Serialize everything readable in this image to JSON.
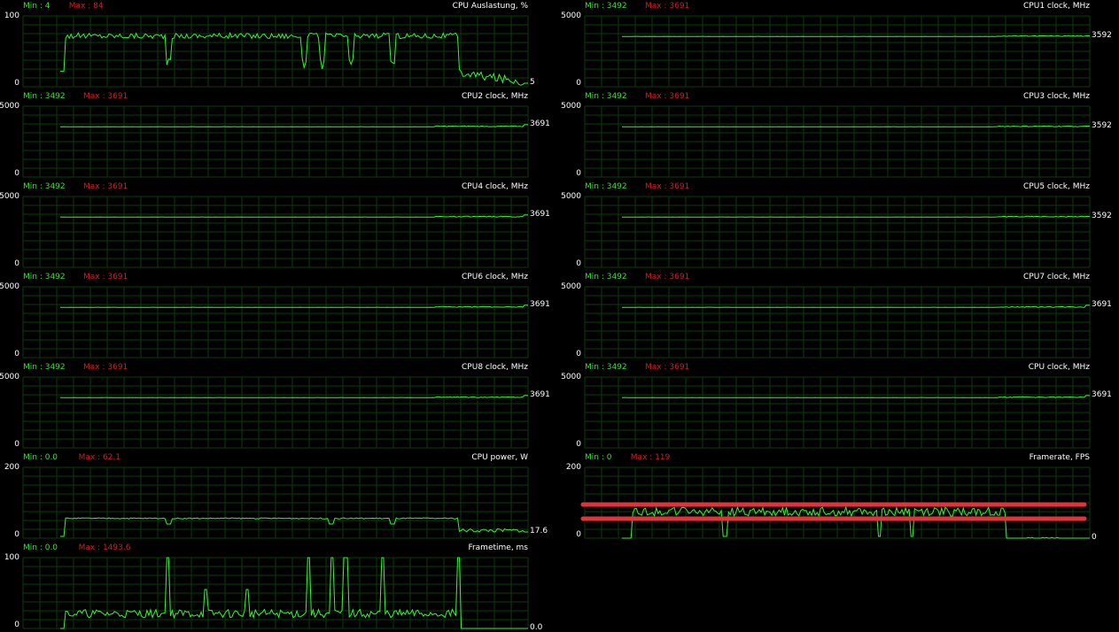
{
  "colors": {
    "background": "#000000",
    "grid": "#0b3a0b",
    "line": "#3cf03c",
    "min_text": "#3fdc3f",
    "max_text": "#d21e1e",
    "marker": "#e0343a"
  },
  "graphs": [
    {
      "id": "cpu-usage",
      "title": "CPU Auslastung, %",
      "min": "Min : 4",
      "max": "Max : 84",
      "top": "100",
      "bottom": "0",
      "current": "5",
      "ymax": 100,
      "profile": "usage",
      "base": 72,
      "endval": 5
    },
    {
      "id": "cpu1-clock",
      "title": "CPU1 clock, MHz",
      "min": "Min : 3492",
      "max": "Max : 3691",
      "top": "5000",
      "bottom": "0",
      "current": "3592",
      "ymax": 5000,
      "profile": "clock",
      "base": 3550,
      "endval": 3592
    },
    {
      "id": "cpu2-clock",
      "title": "CPU2 clock, MHz",
      "min": "Min : 3492",
      "max": "Max : 3691",
      "top": "5000",
      "bottom": "0",
      "current": "3691",
      "ymax": 5000,
      "profile": "clock",
      "base": 3550,
      "endval": 3691
    },
    {
      "id": "cpu3-clock",
      "title": "CPU3 clock, MHz",
      "min": "Min : 3492",
      "max": "Max : 3691",
      "top": "5000",
      "bottom": "0",
      "current": "3592",
      "ymax": 5000,
      "profile": "clock",
      "base": 3550,
      "endval": 3592
    },
    {
      "id": "cpu4-clock",
      "title": "CPU4 clock, MHz",
      "min": "Min : 3492",
      "max": "Max : 3691",
      "top": "5000",
      "bottom": "0",
      "current": "3691",
      "ymax": 5000,
      "profile": "clock",
      "base": 3550,
      "endval": 3691
    },
    {
      "id": "cpu5-clock",
      "title": "CPU5 clock, MHz",
      "min": "Min : 3492",
      "max": "Max : 3691",
      "top": "5000",
      "bottom": "0",
      "current": "3592",
      "ymax": 5000,
      "profile": "clock",
      "base": 3550,
      "endval": 3592
    },
    {
      "id": "cpu6-clock",
      "title": "CPU6 clock, MHz",
      "min": "Min : 3492",
      "max": "Max : 3691",
      "top": "5000",
      "bottom": "0",
      "current": "3691",
      "ymax": 5000,
      "profile": "clock",
      "base": 3550,
      "endval": 3691
    },
    {
      "id": "cpu7-clock",
      "title": "CPU7 clock, MHz",
      "min": "Min : 3492",
      "max": "Max : 3691",
      "top": "5000",
      "bottom": "0",
      "current": "3691",
      "ymax": 5000,
      "profile": "clock",
      "base": 3550,
      "endval": 3691
    },
    {
      "id": "cpu8-clock",
      "title": "CPU8 clock, MHz",
      "min": "Min : 3492",
      "max": "Max : 3691",
      "top": "5000",
      "bottom": "0",
      "current": "3691",
      "ymax": 5000,
      "profile": "clock",
      "base": 3550,
      "endval": 3691
    },
    {
      "id": "cpu-clock",
      "title": "CPU clock, MHz",
      "min": "Min : 3492",
      "max": "Max : 3691",
      "top": "5000",
      "bottom": "0",
      "current": "3691",
      "ymax": 5000,
      "profile": "clock",
      "base": 3550,
      "endval": 3691
    },
    {
      "id": "cpu-power",
      "title": "CPU power, W",
      "min": "Min : 0.0",
      "max": "Max : 62.1",
      "top": "200",
      "bottom": "0",
      "current": "17.6",
      "ymax": 200,
      "profile": "power",
      "base": 56,
      "endval": 17.6
    },
    {
      "id": "framerate",
      "title": "Framerate, FPS",
      "min": "Min : 0",
      "max": "Max : 119",
      "top": "200",
      "bottom": "0",
      "current": "0",
      "ymax": 200,
      "profile": "fps",
      "base": 75,
      "endval": 0
    },
    {
      "id": "frametime",
      "title": "Frametime, ms",
      "min": "Min : 0.0",
      "max": "Max : 1493.6",
      "top": "100",
      "bottom": "0",
      "current": "0.0",
      "ymax": 100,
      "profile": "frametime",
      "base": 15,
      "endval": 0
    }
  ],
  "markers": [
    {
      "graph": "framerate",
      "value": 95
    },
    {
      "graph": "framerate",
      "value": 55
    }
  ]
}
